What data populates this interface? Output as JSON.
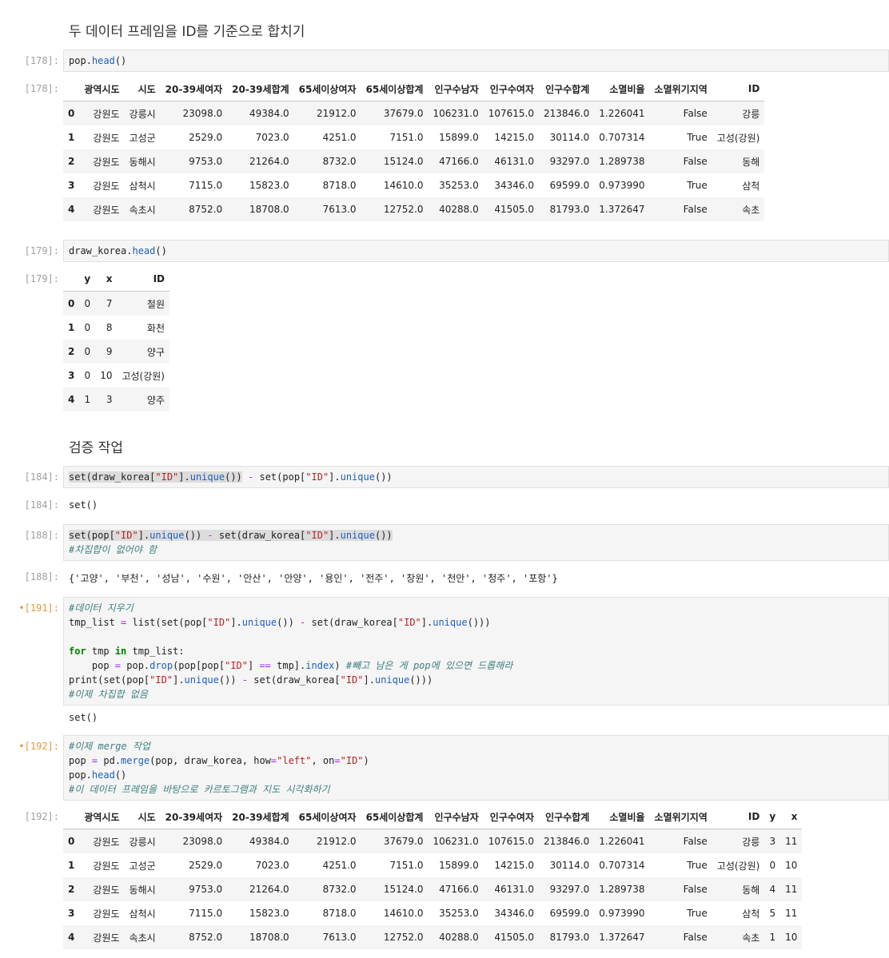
{
  "headings": {
    "merge_title": "두 데이터 프레임을 ID를 기준으로 합치기",
    "verify_title": "검증 작업"
  },
  "prompts": {
    "p178_in": "[178]:",
    "p178_out": "[178]:",
    "p179_in": "[179]:",
    "p179_out": "[179]:",
    "p184_in": "[184]:",
    "p184_out": "[184]:",
    "p188_in": "[188]:",
    "p188_out": "[188]:",
    "p191_in": "•[191]:",
    "p192_in": "•[192]:",
    "p192_out": "[192]:"
  },
  "cells": {
    "c178": {
      "obj": "pop",
      "dot": ".",
      "method": "head",
      "paren": "()"
    },
    "c179": {
      "obj": "draw_korea",
      "dot": ".",
      "method": "head",
      "paren": "()"
    },
    "c184": {
      "a": "set(draw_korea[",
      "s1": "\"ID\"",
      "b": "].",
      "m1": "unique",
      "c": "())",
      "minus": " - ",
      "d": "set(pop[",
      "s2": "\"ID\"",
      "e": "].",
      "m2": "unique",
      "f": "())"
    },
    "c188": {
      "a": "set(pop[",
      "s1": "\"ID\"",
      "b": "].",
      "m1": "unique",
      "c": "())",
      "minus": " - ",
      "d": "set(draw_korea[",
      "s2": "\"ID\"",
      "e": "].",
      "m2": "unique",
      "f": "())",
      "comment": "#차집합이 없어야 함"
    },
    "c191": {
      "l1": "#데이터 지우기",
      "l2a": "tmp_list ",
      "l2eq": "=",
      "l2b": " list(set(pop[",
      "l2s1": "\"ID\"",
      "l2c": "].",
      "l2m1": "unique",
      "l2d": "()) ",
      "l2op": "-",
      "l2e": " set(draw_korea[",
      "l2s2": "\"ID\"",
      "l2f": "].",
      "l2m2": "unique",
      "l2g": "()))",
      "l4kw1": "for",
      "l4a": " tmp ",
      "l4kw2": "in",
      "l4b": " tmp_list:",
      "l5a": "    pop ",
      "l5eq": "=",
      "l5b": " pop.",
      "l5m": "drop",
      "l5c": "(pop[pop[",
      "l5s": "\"ID\"",
      "l5d": "] ",
      "l5eq2": "==",
      "l5e": " tmp].",
      "l5m2": "index",
      "l5f": ") ",
      "l5cm": "#빼고 남은 게 pop에 있으면 드롭해라",
      "l6a": "print(set(pop[",
      "l6s1": "\"ID\"",
      "l6b": "].",
      "l6m1": "unique",
      "l6c": "()) ",
      "l6op": "-",
      "l6d": " set(draw_korea[",
      "l6s2": "\"ID\"",
      "l6e": "].",
      "l6m2": "unique",
      "l6f": "()))",
      "l7": "#이제 차집합 없음"
    },
    "c192": {
      "l1": "#이제 merge 작업",
      "l2a": "pop ",
      "l2eq": "=",
      "l2b": " pd.",
      "l2m": "merge",
      "l2c": "(pop, draw_korea, how",
      "l2eq2": "=",
      "l2s1": "\"left\"",
      "l2d": ", on",
      "l2eq3": "=",
      "l2s2": "\"ID\"",
      "l2e": ")",
      "l3a": "pop.",
      "l3m": "head",
      "l3b": "()",
      "l4": "#이 데이터 프레임을 바탕으로 카르토그램과 지도 시각화하기"
    }
  },
  "outputs": {
    "o184": "set()",
    "o188": "{'고양', '부천', '성남', '수원', '안산', '안양', '용인', '전주', '창원', '천안', '청주', '포항'}",
    "o191": "set()"
  },
  "pop_table": {
    "columns": [
      "",
      "광역시도",
      "시도",
      "20-39세여자",
      "20-39세합계",
      "65세이상여자",
      "65세이상합계",
      "인구수남자",
      "인구수여자",
      "인구수합계",
      "소멸비율",
      "소멸위기지역",
      "ID"
    ],
    "rows": [
      [
        "0",
        "강원도",
        "강릉시",
        "23098.0",
        "49384.0",
        "21912.0",
        "37679.0",
        "106231.0",
        "107615.0",
        "213846.0",
        "1.226041",
        "False",
        "강릉"
      ],
      [
        "1",
        "강원도",
        "고성군",
        "2529.0",
        "7023.0",
        "4251.0",
        "7151.0",
        "15899.0",
        "14215.0",
        "30114.0",
        "0.707314",
        "True",
        "고성(강원)"
      ],
      [
        "2",
        "강원도",
        "동해시",
        "9753.0",
        "21264.0",
        "8732.0",
        "15124.0",
        "47166.0",
        "46131.0",
        "93297.0",
        "1.289738",
        "False",
        "동해"
      ],
      [
        "3",
        "강원도",
        "삼척시",
        "7115.0",
        "15823.0",
        "8718.0",
        "14610.0",
        "35253.0",
        "34346.0",
        "69599.0",
        "0.973990",
        "True",
        "삼척"
      ],
      [
        "4",
        "강원도",
        "속초시",
        "8752.0",
        "18708.0",
        "7613.0",
        "12752.0",
        "40288.0",
        "41505.0",
        "81793.0",
        "1.372647",
        "False",
        "속초"
      ]
    ]
  },
  "draw_table": {
    "columns": [
      "",
      "y",
      "x",
      "ID"
    ],
    "rows": [
      [
        "0",
        "0",
        "7",
        "철원"
      ],
      [
        "1",
        "0",
        "8",
        "화천"
      ],
      [
        "2",
        "0",
        "9",
        "양구"
      ],
      [
        "3",
        "0",
        "10",
        "고성(강원)"
      ],
      [
        "4",
        "1",
        "3",
        "양주"
      ]
    ]
  },
  "merged_table": {
    "columns": [
      "",
      "광역시도",
      "시도",
      "20-39세여자",
      "20-39세합계",
      "65세이상여자",
      "65세이상합계",
      "인구수남자",
      "인구수여자",
      "인구수합계",
      "소멸비율",
      "소멸위기지역",
      "ID",
      "y",
      "x"
    ],
    "rows": [
      [
        "0",
        "강원도",
        "강릉시",
        "23098.0",
        "49384.0",
        "21912.0",
        "37679.0",
        "106231.0",
        "107615.0",
        "213846.0",
        "1.226041",
        "False",
        "강릉",
        "3",
        "11"
      ],
      [
        "1",
        "강원도",
        "고성군",
        "2529.0",
        "7023.0",
        "4251.0",
        "7151.0",
        "15899.0",
        "14215.0",
        "30114.0",
        "0.707314",
        "True",
        "고성(강원)",
        "0",
        "10"
      ],
      [
        "2",
        "강원도",
        "동해시",
        "9753.0",
        "21264.0",
        "8732.0",
        "15124.0",
        "47166.0",
        "46131.0",
        "93297.0",
        "1.289738",
        "False",
        "동해",
        "4",
        "11"
      ],
      [
        "3",
        "강원도",
        "삼척시",
        "7115.0",
        "15823.0",
        "8718.0",
        "14610.0",
        "35253.0",
        "34346.0",
        "69599.0",
        "0.973990",
        "True",
        "삼척",
        "5",
        "11"
      ],
      [
        "4",
        "강원도",
        "속초시",
        "8752.0",
        "18708.0",
        "7613.0",
        "12752.0",
        "40288.0",
        "41505.0",
        "81793.0",
        "1.372647",
        "False",
        "속초",
        "1",
        "10"
      ]
    ]
  }
}
